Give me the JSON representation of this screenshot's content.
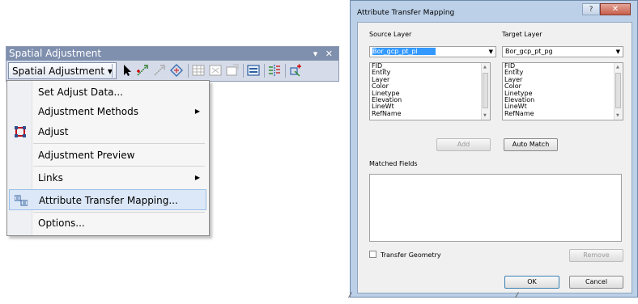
{
  "toolbar": {
    "title": "Spatial Adjustment",
    "title_controls": "▾ ✕",
    "menu_button": "Spatial Adjustment",
    "menu_button_arrow": "▾",
    "icons": [
      "select-arrow-icon",
      "new-displacement-link-icon",
      "modify-link-icon",
      "multi-displacement-links-icon",
      "view-link-table-icon",
      "limited-adjustment-area-icon",
      "clear-area-icon",
      "attribute-transfer-tool-icon",
      "edge-match-tool-icon",
      "new-identity-link-icon"
    ]
  },
  "menu": {
    "items": [
      {
        "label": "Set Adjust Data...",
        "submenu": false
      },
      {
        "label": "Adjustment Methods",
        "submenu": true
      },
      {
        "label": "Adjust",
        "submenu": false
      },
      {
        "label": "Adjustment Preview",
        "submenu": false
      },
      {
        "label": "Links",
        "submenu": true
      },
      {
        "label": "Attribute Transfer Mapping...",
        "submenu": false,
        "highlighted": true
      },
      {
        "label": "Options...",
        "submenu": false
      }
    ]
  },
  "dialog": {
    "title": "Attribute Transfer Mapping",
    "help": "?",
    "close": "✕",
    "source_label": "Source Layer",
    "target_label": "Target Layer",
    "source_value": "Bor_gcp_pt_pl",
    "target_value": "Bor_gcp_pt_pg",
    "source_fields": [
      "FID_",
      "Entity",
      "Layer",
      "Color",
      "Linetype",
      "Elevation",
      "LineWt",
      "RefName"
    ],
    "target_fields": [
      "FID_",
      "Entity",
      "Layer",
      "Color",
      "Linetype",
      "Elevation",
      "LineWt",
      "RefName"
    ],
    "add_label": "Add",
    "auto_match_label": "Auto Match",
    "matched_label": "Matched Fields",
    "transfer_geometry_label": "Transfer Geometry",
    "transfer_geometry_checked": false,
    "remove_label": "Remove",
    "ok_label": "OK",
    "cancel_label": "Cancel"
  },
  "colors": {
    "toolbar_title_bg": "#7f8fae",
    "toolbar_bg": "#d6dbe9",
    "menu_highlight": "#dce8f7",
    "dialog_frame": "#bcd0e8",
    "selection": "#3399ff",
    "close_button": "#c75f4c"
  }
}
